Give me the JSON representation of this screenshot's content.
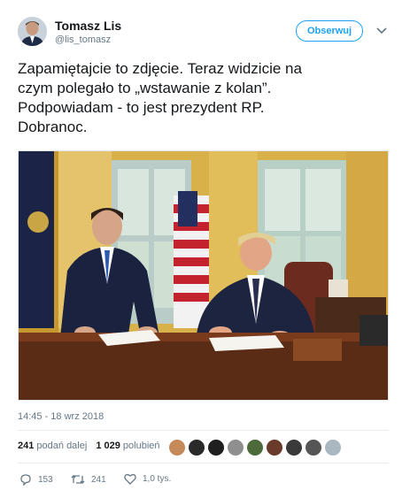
{
  "author": {
    "name": "Tomasz Lis",
    "handle": "@lis_tomasz"
  },
  "follow_label": "Obserwuj",
  "tweet_text": "Zapamiętajcie to zdjęcie. Teraz widzicie na\nczym polegało to „wstawanie z kolan”.\nPodpowiadam - to jest prezydent RP.\nDobranoc.",
  "timestamp": "14:45 - 18 wrz 2018",
  "stats": {
    "retweets_count": "241",
    "retweets_label": "podań dalej",
    "likes_count": "1 029",
    "likes_label": "polubień"
  },
  "actions": {
    "replies": "153",
    "retweets": "241",
    "likes": "1,0 tys."
  },
  "colors": {
    "accent": "#1da1f2",
    "muted": "#657786"
  },
  "icons": [
    "chevron-down-icon",
    "reply-icon",
    "retweet-icon",
    "heart-icon"
  ]
}
